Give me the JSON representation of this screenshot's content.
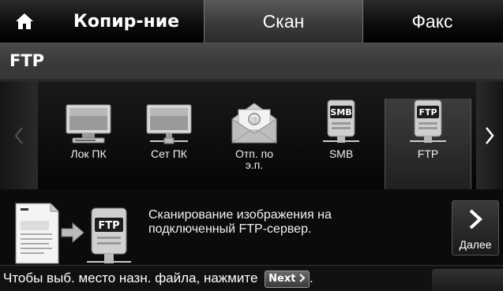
{
  "tabs": {
    "home_icon": "home-icon",
    "copy": "Копир-ние",
    "scan": "Скан",
    "fax": "Факс"
  },
  "title": "FTP",
  "carousel": {
    "items": [
      {
        "label": "Лок ПК",
        "icon": "monitor-icon"
      },
      {
        "label": "Сет ПК",
        "icon": "network-monitor-icon"
      },
      {
        "label": "Отп. по\nэ.п.",
        "label_line1": "Отп. по",
        "label_line2": "э.п.",
        "icon": "email-envelope-icon"
      },
      {
        "label": "SMB",
        "icon": "smb-server-icon",
        "badge": "SMB"
      },
      {
        "label": "FTP",
        "icon": "ftp-server-icon",
        "badge": "FTP",
        "selected": true
      }
    ]
  },
  "description": {
    "badge": "FTP",
    "line1": "Сканирование изображения на",
    "line2": "подключенный FTP-сервер."
  },
  "next_button": {
    "label": "Далее"
  },
  "hint": {
    "text": "Чтобы выб. место назн. файла, нажмите",
    "badge": "Next",
    "end": "."
  }
}
